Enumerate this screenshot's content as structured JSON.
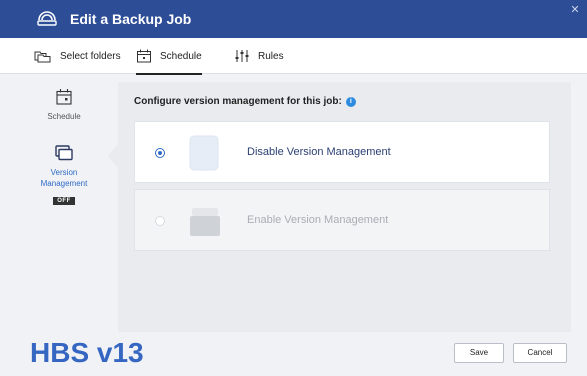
{
  "window": {
    "title": "Edit a Backup Job",
    "close_icon": "close-icon"
  },
  "tabs": [
    {
      "label": "Select folders",
      "icon": "folders-icon",
      "active": false
    },
    {
      "label": "Schedule",
      "icon": "calendar-icon",
      "active": true
    },
    {
      "label": "Rules",
      "icon": "sliders-icon",
      "active": false
    }
  ],
  "sidebar": {
    "items": [
      {
        "label": "Schedule",
        "icon": "calendar-icon",
        "active": false
      },
      {
        "label_line1": "Version",
        "label_line2": "Management",
        "icon": "layers-icon",
        "active": true,
        "badge": "OFF"
      }
    ]
  },
  "main": {
    "heading": "Configure version management for this job:",
    "info_icon": "info-icon",
    "options": [
      {
        "label": "Disable Version Management",
        "selected": true,
        "enabled": true
      },
      {
        "label": "Enable Version Management",
        "selected": false,
        "enabled": false
      }
    ]
  },
  "footer": {
    "watermark": "HBS v13",
    "save_label": "Save",
    "cancel_label": "Cancel"
  },
  "colors": {
    "titlebar": "#2d4d96",
    "accent": "#2e6bc6",
    "watermark": "#3466c2"
  }
}
